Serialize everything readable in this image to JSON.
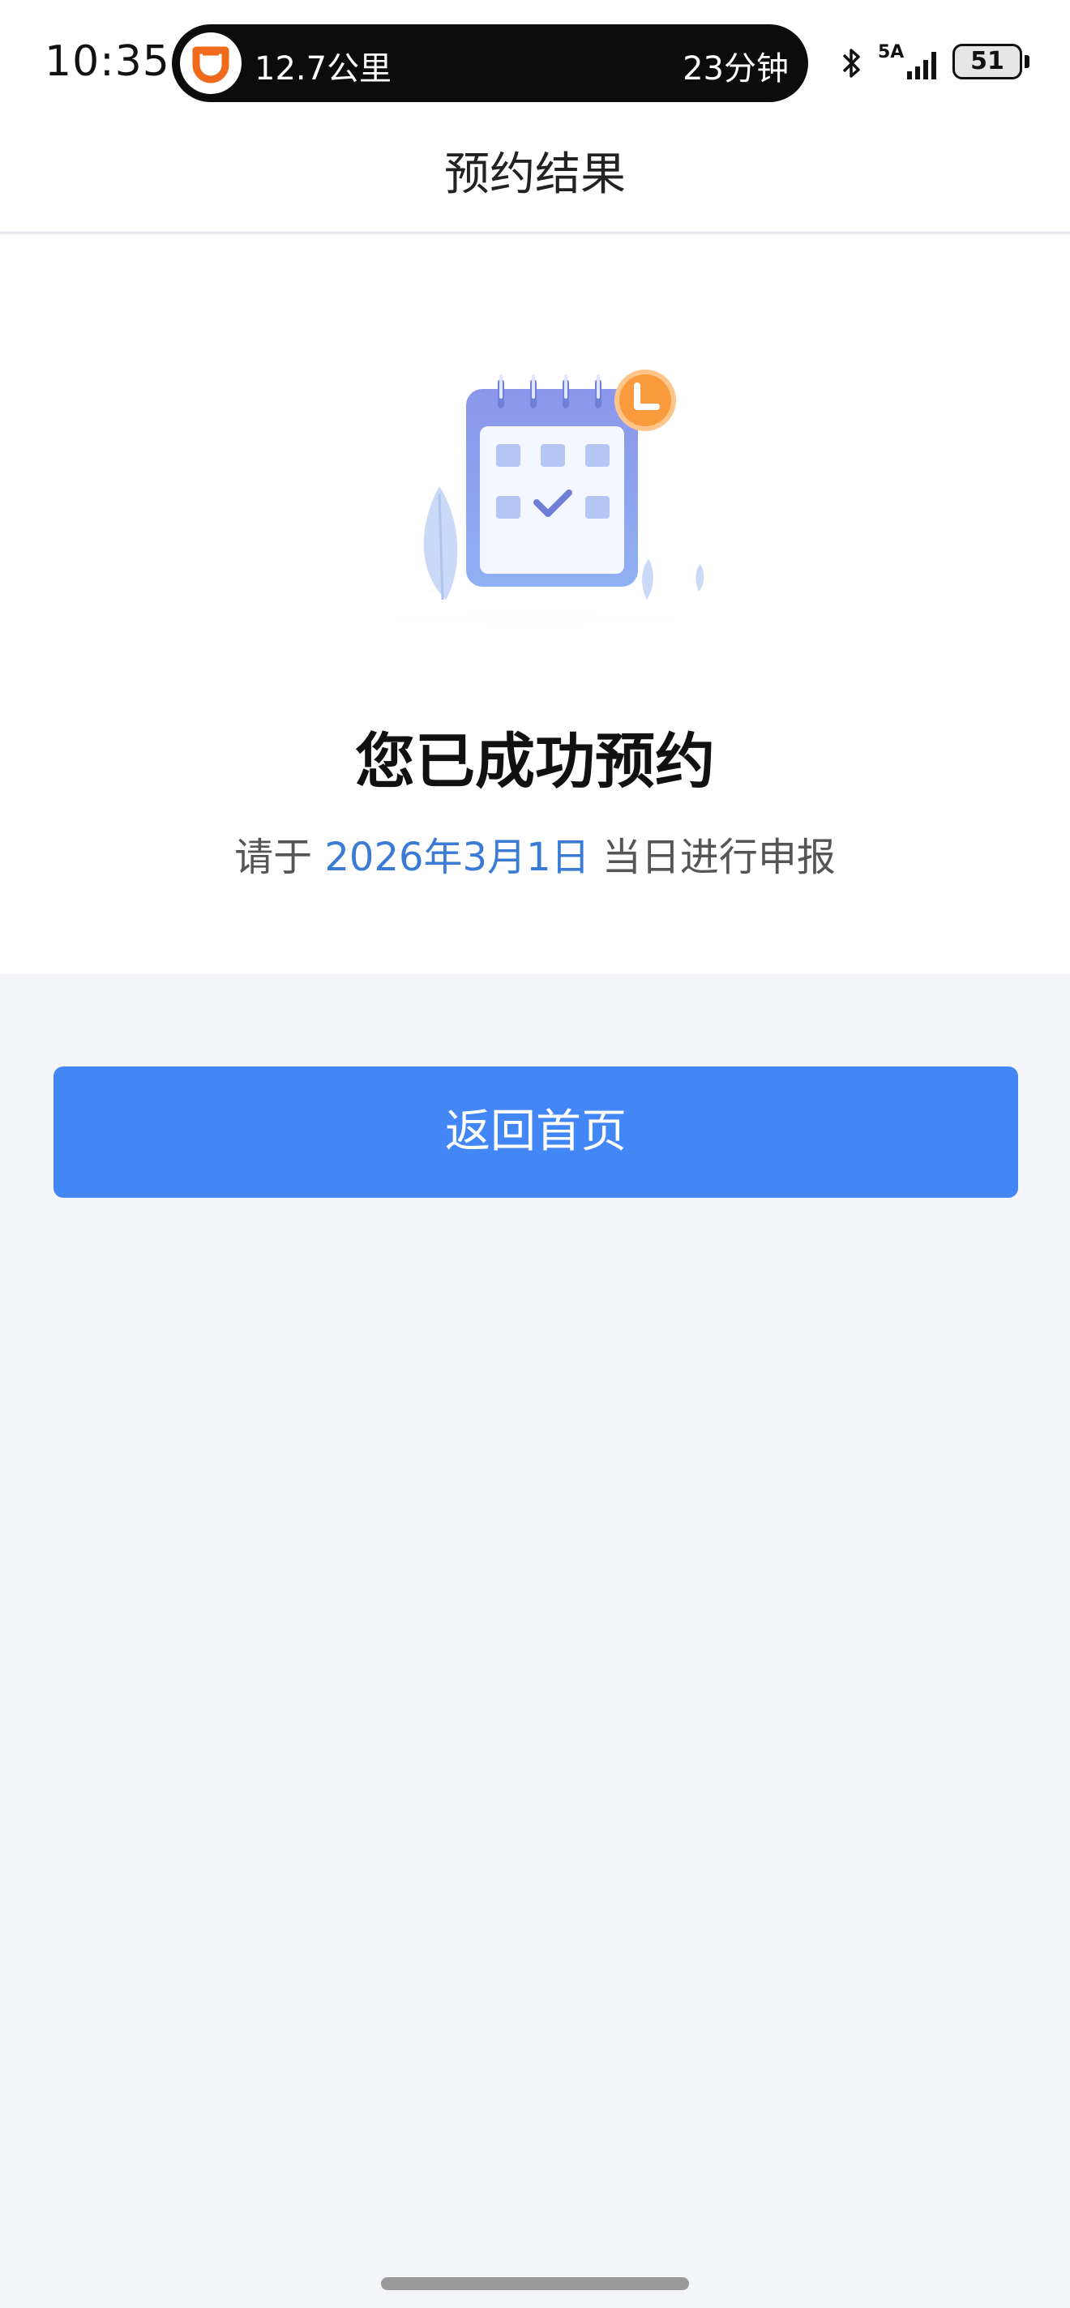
{
  "status_bar": {
    "time": "10:35",
    "island": {
      "distance": "12.7公里",
      "duration": "23分钟",
      "logo_icon": "didi-logo",
      "logo_color": "#f06a1b"
    },
    "network": "5A",
    "battery": "51"
  },
  "header": {
    "title": "预约结果"
  },
  "result": {
    "illustration_icon": "calendar-check-clock-illustration",
    "headline": "您已成功预约",
    "sub_prefix": "请于",
    "sub_date": "2026年3月1日",
    "sub_suffix": "当日进行申报"
  },
  "actions": {
    "home_label": "返回首页",
    "accent": "#4387f6"
  }
}
